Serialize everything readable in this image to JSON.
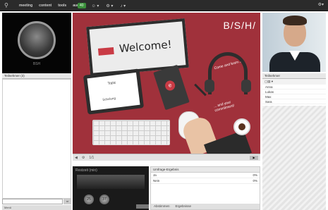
{
  "topbar": {
    "menu": [
      "meeting",
      "content",
      "tools",
      "audio"
    ],
    "pill": "40",
    "tools": [
      "☺ ▾",
      "⚙ ▾",
      "♪ ▾"
    ],
    "right": "⚙▾"
  },
  "clock": {
    "label": "BSH"
  },
  "left_panel": {
    "header": "Teilnehmer (3)",
    "send": "⇨",
    "footer": "Menü"
  },
  "slide": {
    "brand": "B/S/H/",
    "welcome": "Welcome!",
    "tablet_title": "Topic",
    "tablet_sub": "Schulung",
    "notebook_letter": "e",
    "headphones_text": "Come and learn...",
    "headphones_text2": "... and your commitment!"
  },
  "stage_controls": {
    "items": [
      "◀",
      "⚙",
      "1/1"
    ],
    "next": "▶"
  },
  "media": {
    "title": "Restzeit (min)",
    "knob1": "25",
    "knob2": "37"
  },
  "table": {
    "title": "Umfrage-Ergebnis",
    "rows": [
      {
        "label": "Ja",
        "value": "0%"
      },
      {
        "label": "Nein",
        "value": "0%"
      }
    ],
    "footer": [
      "Abstimmen",
      "Ergebnisse"
    ]
  },
  "right_panel": {
    "header": "Teilnehmer",
    "tools": "▢▤ ▾",
    "items": [
      "Anna",
      "Lukas",
      "Max",
      "Sara"
    ]
  }
}
